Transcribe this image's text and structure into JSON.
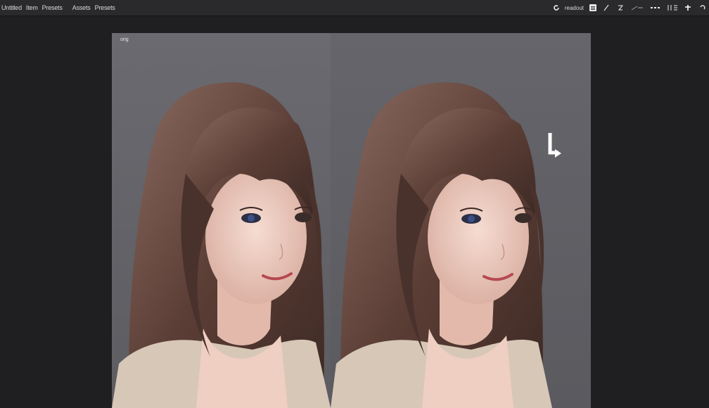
{
  "menubar": {
    "items": [
      "Untitled",
      "Item",
      "Presets",
      "Assets",
      "Presets"
    ],
    "status": "readout",
    "icons": [
      "refresh-icon",
      "menu-icon",
      "pen-icon",
      "zoom-icon",
      "line-icon",
      "more-icon",
      "grid-icon",
      "plus-icon",
      "undo-icon"
    ]
  },
  "canvas": {
    "label": "orig"
  },
  "colors": {
    "background": "#1f1f21",
    "menubar": "#2a2a2c",
    "canvas": "#66666b",
    "hair": "#5a3f38",
    "skin": "#f1d2c6",
    "top": "#d6c8b8"
  }
}
